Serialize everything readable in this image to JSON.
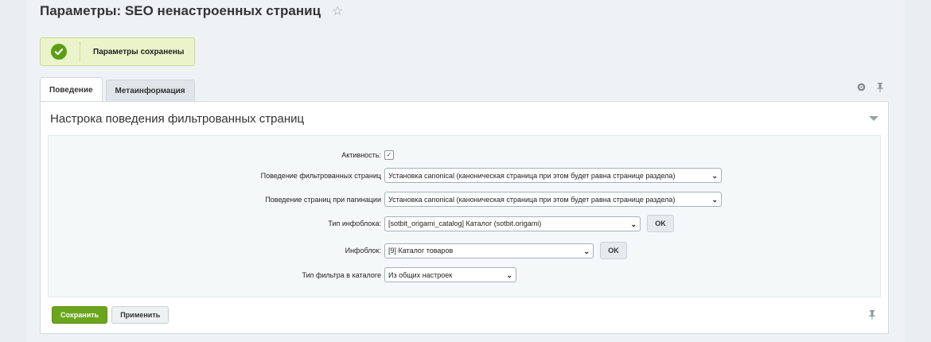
{
  "page": {
    "title": "Параметры: SEO ненастроенных страниц",
    "star": "☆"
  },
  "notice": {
    "text": "Параметры сохранены"
  },
  "tabs": [
    {
      "label": "Поведение",
      "active": true
    },
    {
      "label": "Метаинформация",
      "active": false
    }
  ],
  "section": {
    "title": "Настрока поведения фильтрованных страниц"
  },
  "form": {
    "active": {
      "label": "Активность:",
      "checked": true
    },
    "filtered_behavior": {
      "label": "Поведение фильтрованных страниц",
      "value": "Установка canonical (каноническая страница при этом будет равна странице раздела)"
    },
    "pagination_behavior": {
      "label": "Поведение страниц при пагинации",
      "value": "Установка canonical (каноническая страница при этом будет равна странице раздела)"
    },
    "iblock_type": {
      "label": "Тип инфоблока:",
      "value": "[sotbit_origami_catalog] Каталог (sotbit.origami)",
      "ok_label": "OK"
    },
    "iblock": {
      "label": "Инфоблок:",
      "value": "[9] Каталог товаров",
      "ok_label": "OK"
    },
    "filter_type": {
      "label": "Тип фильтра в каталоге",
      "value": "Из общих настроек"
    }
  },
  "footer": {
    "save_label": "Сохранить",
    "apply_label": "Применить"
  },
  "colors": {
    "save_button": "#6aa51c",
    "notice_bg": "#eaf3c9",
    "success_icon": "#5b9e16"
  }
}
